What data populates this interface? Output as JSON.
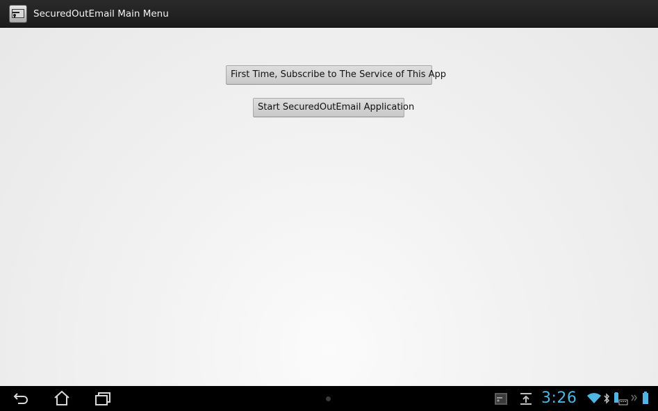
{
  "window": {
    "title": "SecuredOutEmail Main Menu",
    "app_icon": "app-icon"
  },
  "main": {
    "subscribe_button_label": "First Time, Subscribe to The Service of This App",
    "start_button_label": "Start SecuredOutEmail Application"
  },
  "system_bar": {
    "nav": [
      "back-icon",
      "home-icon",
      "recent-apps-icon"
    ],
    "time": "3:26",
    "status_icons": [
      "screenshot-icon",
      "upload-icon",
      "wifi-icon",
      "bluetooth-icon",
      "keyboard-icon",
      "more-icon",
      "battery-icon"
    ],
    "accent_color": "#4fb6e3"
  }
}
